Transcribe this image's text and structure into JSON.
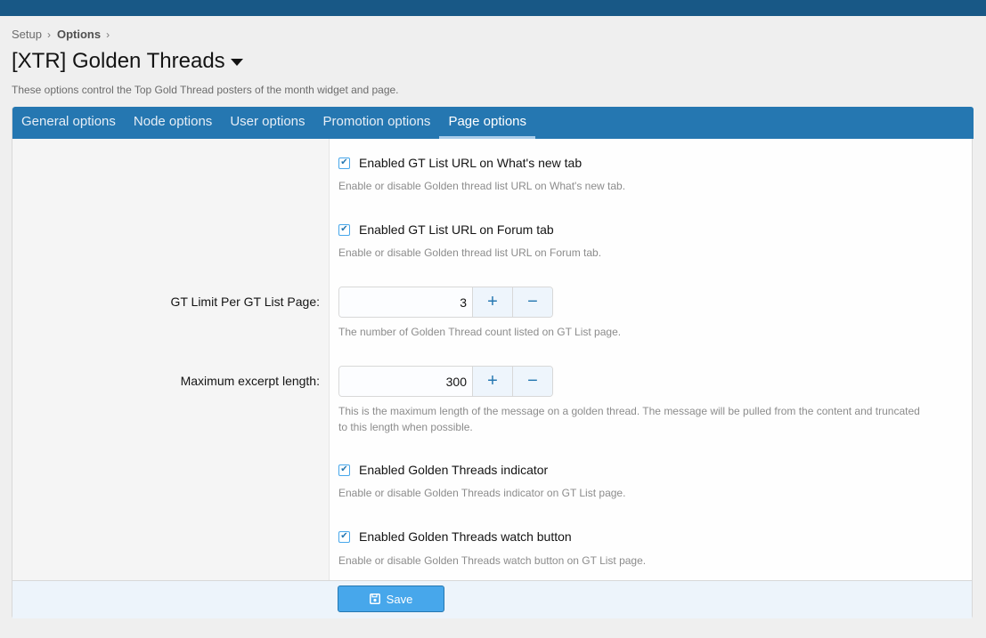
{
  "breadcrumb": {
    "items": [
      "Setup",
      "Options"
    ]
  },
  "page": {
    "title": "[XTR] Golden Threads",
    "description": "These options control the Top Gold Thread posters of the month widget and page."
  },
  "tabs": [
    {
      "label": "General options",
      "active": false
    },
    {
      "label": "Node options",
      "active": false
    },
    {
      "label": "User options",
      "active": false
    },
    {
      "label": "Promotion options",
      "active": false
    },
    {
      "label": "Page options",
      "active": true
    }
  ],
  "options": {
    "whats_new": {
      "label": "Enabled GT List URL on What's new tab",
      "checked": true,
      "hint": "Enable or disable Golden thread list URL on What's new tab."
    },
    "forum_tab": {
      "label": "Enabled GT List URL on Forum tab",
      "checked": true,
      "hint": "Enable or disable Golden thread list URL on Forum tab."
    },
    "gt_limit": {
      "label": "GT Limit Per GT List Page:",
      "value": "3",
      "hint": "The number of Golden Thread count listed on GT List page."
    },
    "excerpt_length": {
      "label": "Maximum excerpt length:",
      "value": "300",
      "hint": "This is the maximum length of the message on a golden thread. The message will be pulled from the content and truncated to this length when possible."
    },
    "indicator": {
      "label": "Enabled Golden Threads indicator",
      "checked": true,
      "hint": "Enable or disable Golden Threads indicator on GT List page."
    },
    "watch_button": {
      "label": "Enabled Golden Threads watch button",
      "checked": true,
      "hint": "Enable or disable Golden Threads watch button on GT List page."
    }
  },
  "spinner": {
    "increment": "+",
    "decrement": "−"
  },
  "footer": {
    "save_label": "Save"
  },
  "icons": {
    "breadcrumb_separator": "chevron-right-icon",
    "title_menu": "caret-down-icon",
    "checkbox": "check-icon",
    "save": "floppy-disk-icon"
  },
  "colors": {
    "header": "#185886",
    "tabs": "#2577b1",
    "button": "#47a7eb",
    "footer": "#edf4fb"
  }
}
